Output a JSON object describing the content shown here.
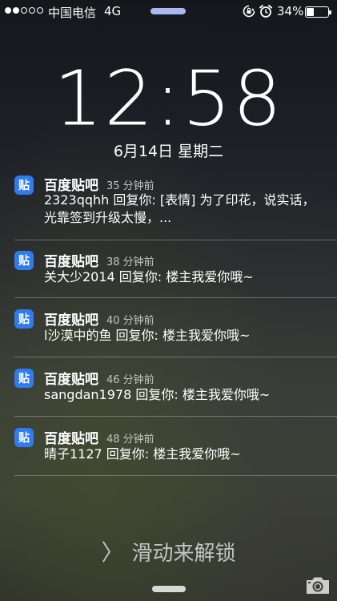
{
  "status_bar": {
    "signal_total": 5,
    "signal_filled": 2,
    "carrier": "中国电信",
    "network": "4G",
    "battery_percent_label": "34%",
    "battery_level": 0.34,
    "icons": [
      "rotation-lock-icon",
      "alarm-icon",
      "battery-icon"
    ]
  },
  "lock_screen": {
    "time": "12:58",
    "date": "6月14日 星期二",
    "unlock_text": "滑动来解锁",
    "unlock_chevron": "〉"
  },
  "notifications": [
    {
      "app_icon_glyph": "贴",
      "app": "百度贴吧",
      "time_ago": "35 分钟前",
      "message": "2323qqhh 回复你: [表情] 为了印花，说实话，光靠签到升级太慢，..."
    },
    {
      "app_icon_glyph": "贴",
      "app": "百度贴吧",
      "time_ago": "38 分钟前",
      "message": "关大少2014 回复你: 楼主我爱你哦~"
    },
    {
      "app_icon_glyph": "贴",
      "app": "百度贴吧",
      "time_ago": "40 分钟前",
      "message": "l沙漠中的鱼 回复你: 楼主我爱你哦~"
    },
    {
      "app_icon_glyph": "贴",
      "app": "百度贴吧",
      "time_ago": "46 分钟前",
      "message": "sangdan1978 回复你: 楼主我爱你哦~"
    },
    {
      "app_icon_glyph": "贴",
      "app": "百度贴吧",
      "time_ago": "48 分钟前",
      "message": "晴子1127 回复你: 楼主我爱你哦~"
    }
  ],
  "colors": {
    "app_icon_bg": "#2f7cf0",
    "grabber_top": "#a9b8f0"
  }
}
